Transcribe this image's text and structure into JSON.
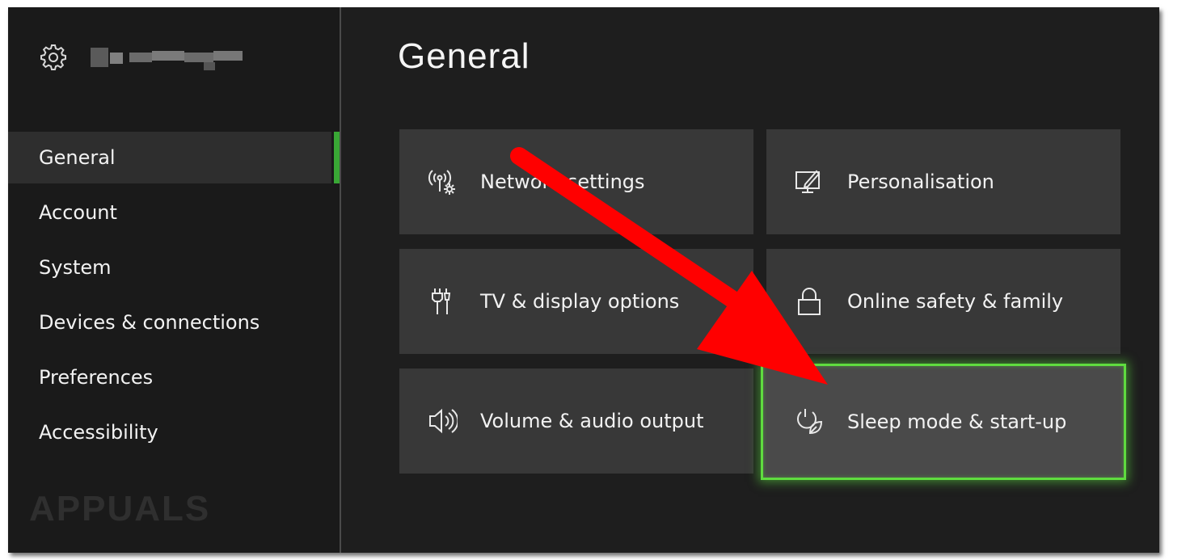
{
  "page": {
    "title": "General"
  },
  "sidebar": {
    "items": [
      {
        "label": "General",
        "selected": true
      },
      {
        "label": "Account"
      },
      {
        "label": "System"
      },
      {
        "label": "Devices & connections"
      },
      {
        "label": "Preferences"
      },
      {
        "label": "Accessibility"
      }
    ]
  },
  "tiles": [
    {
      "label": "Network settings",
      "icon": "network-settings-icon"
    },
    {
      "label": "Personalisation",
      "icon": "personalisation-icon"
    },
    {
      "label": "TV & display options",
      "icon": "tv-display-icon"
    },
    {
      "label": "Online safety & family",
      "icon": "lock-icon"
    },
    {
      "label": "Volume & audio output",
      "icon": "speaker-icon"
    },
    {
      "label": "Sleep mode & start-up",
      "icon": "power-leaf-icon",
      "focused": true
    }
  ],
  "colors": {
    "accent": "#39a835",
    "focus_glow": "#5fdc3f",
    "annotation_arrow": "#ff0000"
  },
  "watermark": {
    "text": "APPUALS"
  }
}
